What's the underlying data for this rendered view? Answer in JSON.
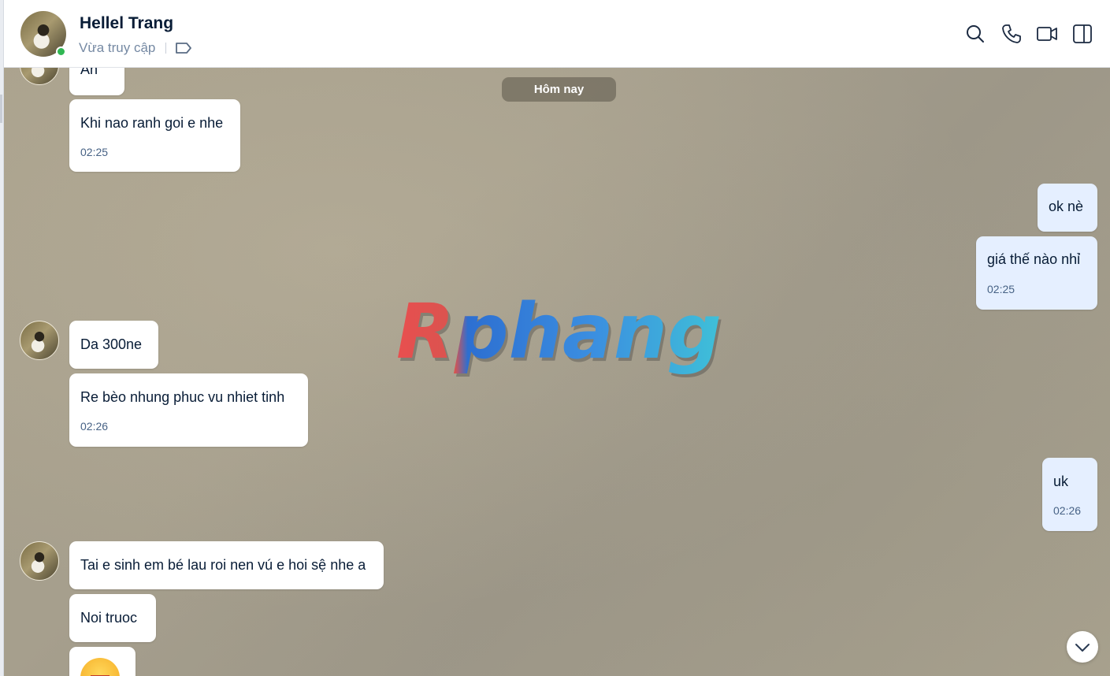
{
  "header": {
    "contact_name": "Hellel Trang",
    "status": "Vừa truy cập",
    "online": true,
    "icons": [
      "search-icon",
      "phone-icon",
      "video-call-icon",
      "sidebar-toggle-icon"
    ]
  },
  "chat": {
    "date_divider": "Hôm nay",
    "watermark": "Rphang",
    "messages": [
      {
        "from": "contact",
        "text": "Ah",
        "time": ""
      },
      {
        "from": "contact",
        "text": "Khi nao ranh goi e nhe",
        "time": "02:25"
      },
      {
        "from": "me",
        "text": "ok nè",
        "time": ""
      },
      {
        "from": "me",
        "text": "giá thế nào nhỉ",
        "time": "02:25"
      },
      {
        "from": "contact",
        "text": "Da 300ne",
        "time": ""
      },
      {
        "from": "contact",
        "text": "Re bèo nhung phuc vu nhiet tinh",
        "time": "02:26"
      },
      {
        "from": "me",
        "text": "uk",
        "time": "02:26"
      },
      {
        "from": "contact",
        "text": "Tai e sinh em bé lau roi nen vú e hoi sệ nhe a",
        "time": ""
      },
      {
        "from": "contact",
        "text": "Noi truoc",
        "time": ""
      },
      {
        "from": "contact",
        "text": "",
        "time": "",
        "sticker": "laughing-emoji-icon"
      }
    ]
  },
  "colors": {
    "accent": "#0068ff",
    "my_bubble": "#e5efff",
    "contact_bubble": "#ffffff",
    "online": "#30b753",
    "chat_background": "#a69f8d"
  }
}
